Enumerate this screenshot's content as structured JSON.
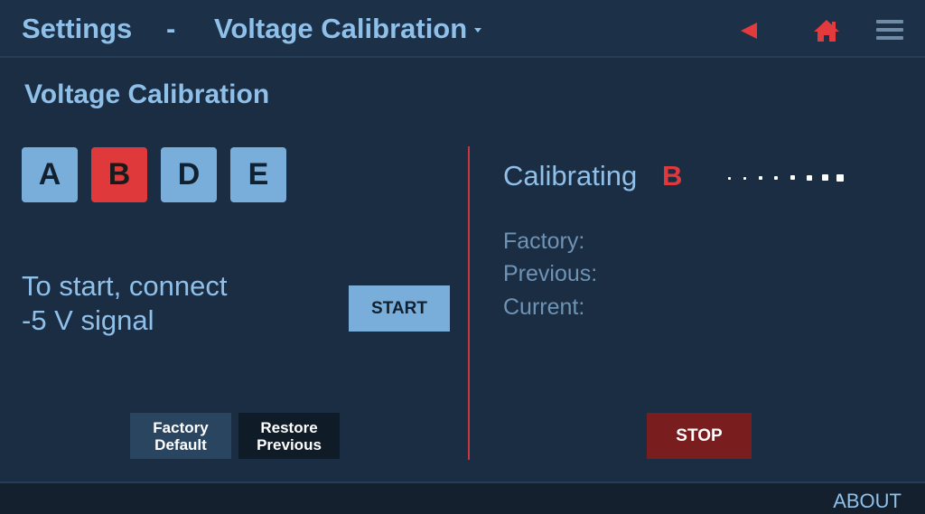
{
  "header": {
    "settings_label": "Settings",
    "separator": "-",
    "page_label": "Voltage Calibration",
    "icons": {
      "back": "back-arrow-icon",
      "home": "home-icon",
      "menu": "menu-icon"
    },
    "accent_color": "#e23a3d"
  },
  "section": {
    "title": "Voltage Calibration"
  },
  "channels": [
    {
      "label": "A",
      "selected": false
    },
    {
      "label": "B",
      "selected": true
    },
    {
      "label": "D",
      "selected": false
    },
    {
      "label": "E",
      "selected": false
    }
  ],
  "instruction": {
    "line1": "To start, connect",
    "line2": "-5 V signal"
  },
  "buttons": {
    "start": "START",
    "factory_default_line1": "Factory",
    "factory_default_line2": "Default",
    "restore_previous_line1": "Restore",
    "restore_previous_line2": "Previous",
    "stop": "STOP"
  },
  "status": {
    "calibrating_label": "Calibrating",
    "calibrating_channel": "B",
    "factory_label": "Factory:",
    "previous_label": "Previous:",
    "current_label": "Current:"
  },
  "footer": {
    "about": "ABOUT"
  },
  "colors": {
    "background": "#1b2d42",
    "text_primary": "#8fc0ea",
    "button_blue": "#79aedb",
    "selected_red": "#e0393b",
    "stop_red": "#7a1d1f"
  }
}
